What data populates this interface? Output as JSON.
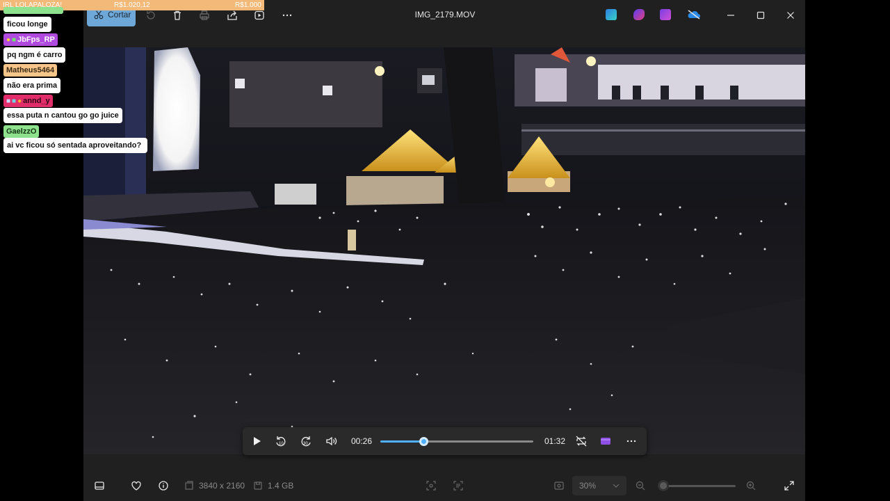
{
  "stream_overlay": {
    "donation_bar": {
      "goal_label": "IRL LOLAPALOZA!",
      "current": "R$1.020,12",
      "target": "R$1.000",
      "progress": 1.02
    },
    "chat": [
      {
        "user": "",
        "message": "ficou longe",
        "badge_color": "#8ee28e"
      },
      {
        "user": "JbFps_RP",
        "message": "pq ngm é carro",
        "badge_color": "#b04adf"
      },
      {
        "user": "Matheus5464",
        "message": "não era prima",
        "badge_color": "#f6c58a"
      },
      {
        "user": "annd_y",
        "message": "essa puta n cantou go go juice",
        "badge_color": "#e22d6b"
      },
      {
        "user": "GaelzzO",
        "message": "ai vc ficou só sentada aproveitando?",
        "badge_color": "#8ee28e"
      }
    ]
  },
  "app": {
    "window_title": "IMG_2179.MOV",
    "toolbar": {
      "cut_label": "Cortar",
      "buttons": [
        "rotate-icon",
        "delete-icon",
        "print-icon",
        "share-icon",
        "slideshow-icon",
        "more-icon"
      ]
    },
    "taskbar_apps": [
      "clipchamp-icon",
      "copilot-icon",
      "video-editor-icon",
      "onedrive-icon"
    ],
    "player": {
      "current_time": "00:26",
      "duration": "01:32",
      "progress": 0.28
    },
    "bottombar": {
      "resolution": "3840 x 2160",
      "file_size": "1.4 GB",
      "zoom_value": "30%",
      "zoom_level": 0.0
    }
  }
}
